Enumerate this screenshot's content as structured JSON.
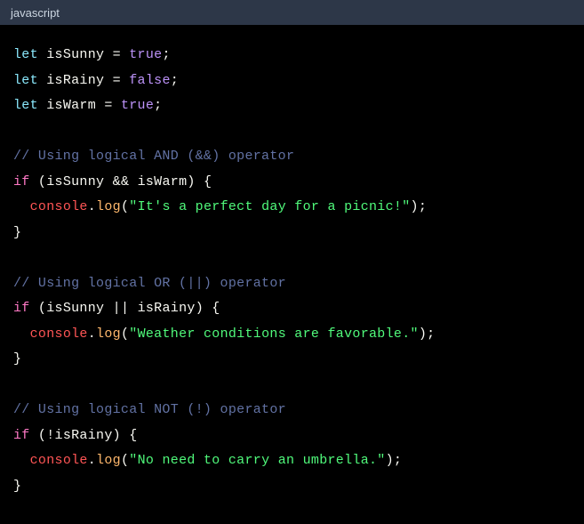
{
  "header": {
    "language": "javascript"
  },
  "code": {
    "lines": [
      [
        {
          "t": "let ",
          "c": "declare"
        },
        {
          "t": "isSunny",
          "c": "ident"
        },
        {
          "t": " = ",
          "c": "punct"
        },
        {
          "t": "true",
          "c": "bool"
        },
        {
          "t": ";",
          "c": "punct"
        }
      ],
      [
        {
          "t": "let ",
          "c": "declare"
        },
        {
          "t": "isRainy",
          "c": "ident"
        },
        {
          "t": " = ",
          "c": "punct"
        },
        {
          "t": "false",
          "c": "bool"
        },
        {
          "t": ";",
          "c": "punct"
        }
      ],
      [
        {
          "t": "let ",
          "c": "declare"
        },
        {
          "t": "isWarm",
          "c": "ident"
        },
        {
          "t": " = ",
          "c": "punct"
        },
        {
          "t": "true",
          "c": "bool"
        },
        {
          "t": ";",
          "c": "punct"
        }
      ],
      [],
      [
        {
          "t": "// Using logical AND (&&) operator",
          "c": "comment"
        }
      ],
      [
        {
          "t": "if",
          "c": "keyword"
        },
        {
          "t": " (",
          "c": "punct"
        },
        {
          "t": "isSunny",
          "c": "ident"
        },
        {
          "t": " && ",
          "c": "punct"
        },
        {
          "t": "isWarm",
          "c": "ident"
        },
        {
          "t": ") {",
          "c": "punct"
        }
      ],
      [
        {
          "t": "  ",
          "c": "punct"
        },
        {
          "t": "console",
          "c": "obj"
        },
        {
          "t": ".",
          "c": "punct"
        },
        {
          "t": "log",
          "c": "method"
        },
        {
          "t": "(",
          "c": "punct"
        },
        {
          "t": "\"It's a perfect day for a picnic!\"",
          "c": "string"
        },
        {
          "t": ");",
          "c": "punct"
        }
      ],
      [
        {
          "t": "}",
          "c": "punct"
        }
      ],
      [],
      [
        {
          "t": "// Using logical OR (||) operator",
          "c": "comment"
        }
      ],
      [
        {
          "t": "if",
          "c": "keyword"
        },
        {
          "t": " (",
          "c": "punct"
        },
        {
          "t": "isSunny",
          "c": "ident"
        },
        {
          "t": " || ",
          "c": "punct"
        },
        {
          "t": "isRainy",
          "c": "ident"
        },
        {
          "t": ") {",
          "c": "punct"
        }
      ],
      [
        {
          "t": "  ",
          "c": "punct"
        },
        {
          "t": "console",
          "c": "obj"
        },
        {
          "t": ".",
          "c": "punct"
        },
        {
          "t": "log",
          "c": "method"
        },
        {
          "t": "(",
          "c": "punct"
        },
        {
          "t": "\"Weather conditions are favorable.\"",
          "c": "string"
        },
        {
          "t": ");",
          "c": "punct"
        }
      ],
      [
        {
          "t": "}",
          "c": "punct"
        }
      ],
      [],
      [
        {
          "t": "// Using logical NOT (!) operator",
          "c": "comment"
        }
      ],
      [
        {
          "t": "if",
          "c": "keyword"
        },
        {
          "t": " (!",
          "c": "punct"
        },
        {
          "t": "isRainy",
          "c": "ident"
        },
        {
          "t": ") {",
          "c": "punct"
        }
      ],
      [
        {
          "t": "  ",
          "c": "punct"
        },
        {
          "t": "console",
          "c": "obj"
        },
        {
          "t": ".",
          "c": "punct"
        },
        {
          "t": "log",
          "c": "method"
        },
        {
          "t": "(",
          "c": "punct"
        },
        {
          "t": "\"No need to carry an umbrella.\"",
          "c": "string"
        },
        {
          "t": ");",
          "c": "punct"
        }
      ],
      [
        {
          "t": "}",
          "c": "punct"
        }
      ]
    ]
  }
}
